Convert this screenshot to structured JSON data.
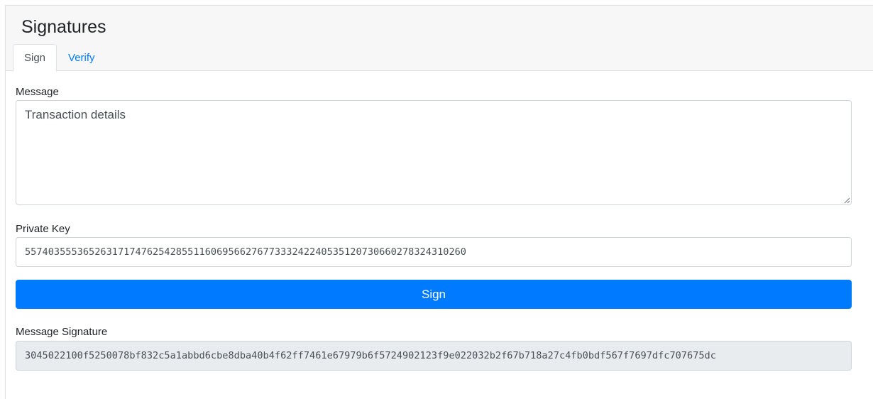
{
  "card": {
    "title": "Signatures",
    "tabs": [
      {
        "label": "Sign",
        "active": true
      },
      {
        "label": "Verify",
        "active": false
      }
    ]
  },
  "sign_form": {
    "message_label": "Message",
    "message_value": "Transaction details",
    "private_key_label": "Private Key",
    "private_key_value": "5574035553652631717476254285511606956627677333242240535120730660278324310260",
    "sign_button_label": "Sign",
    "signature_label": "Message Signature",
    "signature_value": "3045022100f5250078bf832c5a1abbd6cbe8dba40b4f62ff7461e67979b6f5724902123f9e022032b2f67b718a27c4fb0bdf567f7697dfc707675dc"
  },
  "colors": {
    "primary": "#007bff",
    "header_bg": "#f7f7f7",
    "readonly_bg": "#e9ecef"
  }
}
